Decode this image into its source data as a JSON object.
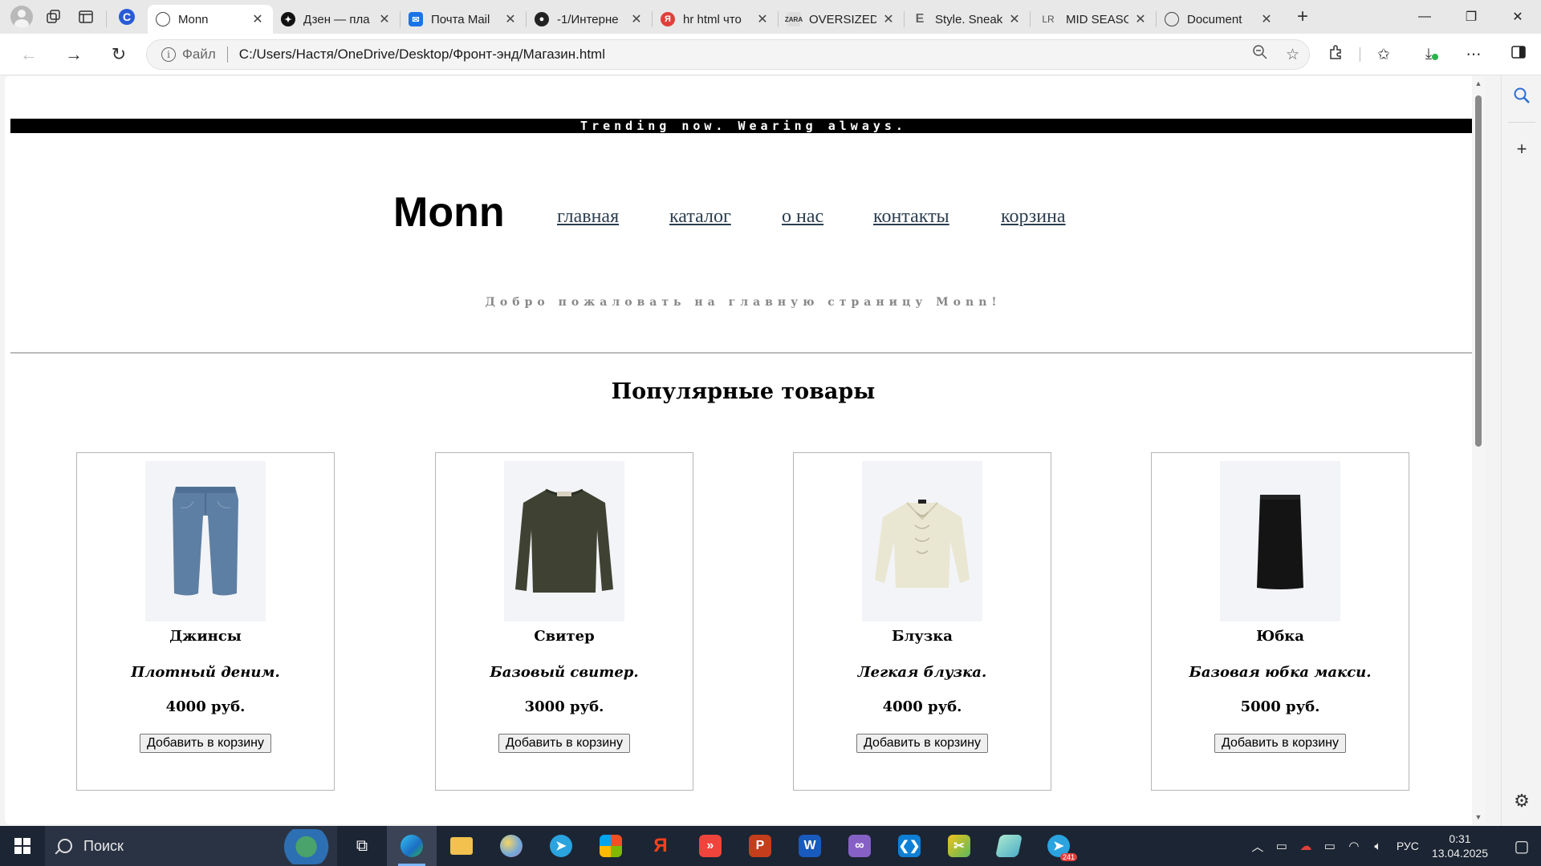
{
  "browser": {
    "tabs": [
      {
        "title": "Monn",
        "active": true,
        "favicon": "globe-icon"
      },
      {
        "title": "Дзен — пла",
        "favicon": "dzen-icon"
      },
      {
        "title": "Почта Mail",
        "favicon": "mail-icon"
      },
      {
        "title": "-1/Интерне",
        "favicon": "github-icon"
      },
      {
        "title": "hr html что",
        "favicon": "yandex-icon"
      },
      {
        "title": "OVERSIZED",
        "favicon": "zara-icon"
      },
      {
        "title": "Style. Sneak",
        "favicon": "e-icon"
      },
      {
        "title": "MID SEASO",
        "favicon": "lr-icon"
      },
      {
        "title": "Document",
        "favicon": "globe-icon"
      }
    ],
    "address": {
      "scheme_label": "Файл",
      "url": "C:/Users/Настя/OneDrive/Desktop/Фронт-энд/Магазин.html"
    }
  },
  "site": {
    "banner": "Trending now. Wearing always.",
    "logo": "Monn",
    "nav": [
      "главная",
      "каталог",
      "о нас",
      "контакты",
      "корзина"
    ],
    "welcome": "Добро пожаловать на главную страницу Monn!",
    "section_title": "Популярные товары",
    "products": [
      {
        "name": "Джинсы",
        "description": "Плотный деним.",
        "price": "4000 руб.",
        "button": "Добавить в корзину",
        "image": "jeans"
      },
      {
        "name": "Свитер",
        "description": "Базовый свитер.",
        "price": "3000 руб.",
        "button": "Добавить в корзину",
        "image": "sweater"
      },
      {
        "name": "Блузка",
        "description": "Легкая блузка.",
        "price": "4000 руб.",
        "button": "Добавить в корзину",
        "image": "blouse"
      },
      {
        "name": "Юбка",
        "description": "Базовая юбка макси.",
        "price": "5000 руб.",
        "button": "Добавить в корзину",
        "image": "skirt"
      }
    ]
  },
  "taskbar": {
    "search_placeholder": "Поиск",
    "language": "РУС",
    "time": "0:31",
    "date": "13.04.2025",
    "telegram_badge": "241"
  },
  "colors": {
    "banner_bg": "#000000",
    "nav_link": "#2c3e50",
    "welcome_text": "#888888",
    "taskbar_bg": "#1c2533"
  }
}
